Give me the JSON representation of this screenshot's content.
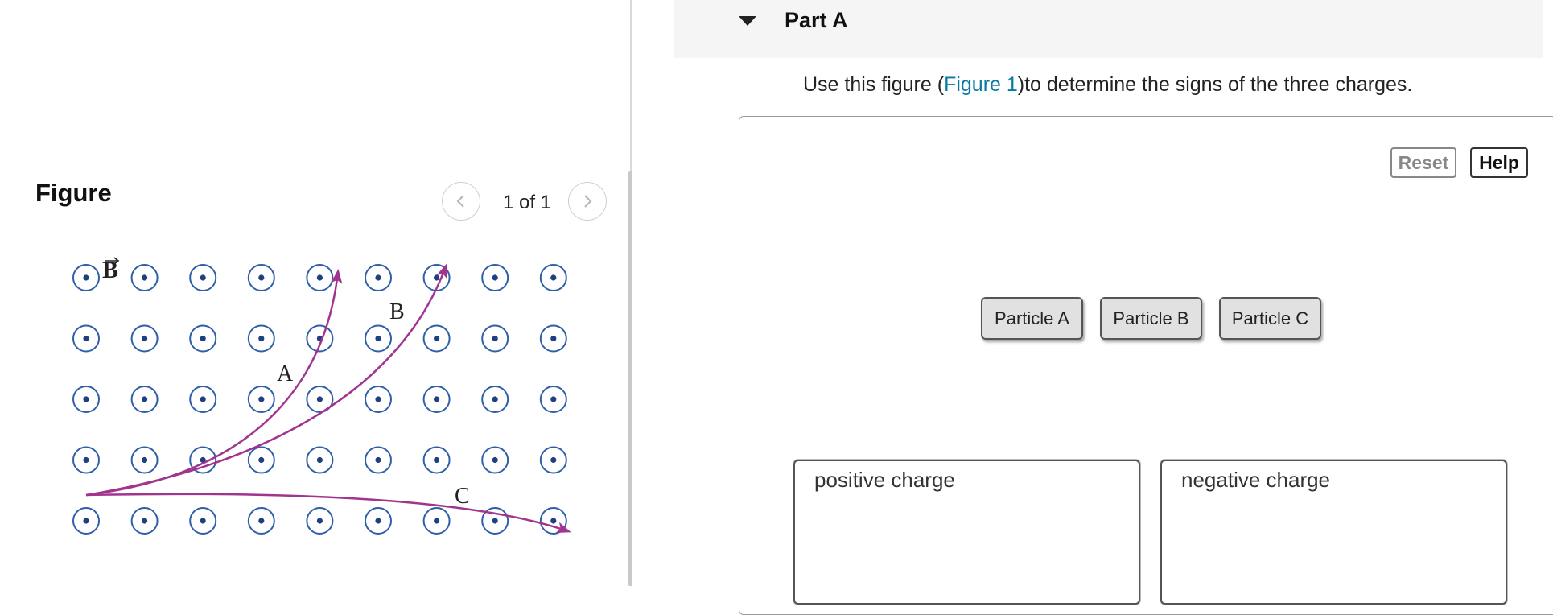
{
  "figure_panel": {
    "title": "Figure",
    "pager": "1 of 1",
    "prev_icon": "chevron-left-icon",
    "next_icon": "chevron-right-icon",
    "diagram": {
      "field_label": "B",
      "path_labels": [
        "A",
        "B",
        "C"
      ],
      "path_color": "#a0348f",
      "symbol_color": "#2f5fa8"
    }
  },
  "part": {
    "title": "Part A",
    "instruction_before": "Use this figure (",
    "figure_link": "Figure 1",
    "instruction_after": ")to determine the signs of the three charges."
  },
  "toolbar": {
    "reset_label": "Reset",
    "help_label": "Help"
  },
  "chips": [
    "Particle A",
    "Particle B",
    "Particle C"
  ],
  "zones": {
    "positive_label": "positive charge",
    "negative_label": "negative charge"
  }
}
